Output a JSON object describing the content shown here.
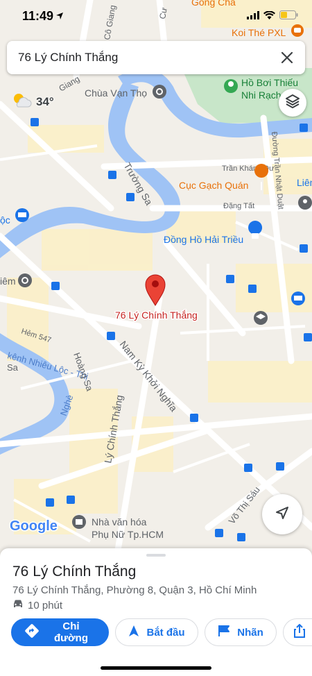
{
  "status": {
    "time": "11:49"
  },
  "search": {
    "query": "76 Lý Chính Thắng"
  },
  "weather": {
    "temp": "34°"
  },
  "map": {
    "pin_label": "76 Lý Chính Thắng",
    "logo": "Google",
    "places": {
      "gong_cha": "Gong Cha",
      "koi_the": "Koi Thé PXL",
      "ho_boi_1": "Hồ Bơi Thiếu",
      "ho_boi_2": "Nhi Rạch",
      "chua_van_tho": "Chùa Vạn Thọ",
      "cuc_gach_quan": "Cục Gạch Quán",
      "dong_ho_hai_trieu": "Đồng Hồ Hải Triều",
      "lien": "Liên",
      "loc": "ộc",
      "iem": "iêm",
      "nha_van_hoa_1": "Nhà văn hóa",
      "nha_van_hoa_2": "Phụ Nữ Tp.HCM"
    },
    "streets": {
      "co_giang": "Cô Giang",
      "giang": "Giang",
      "cu": "Cư",
      "truong_sa": "Trường Sa",
      "tran_khanh_du": "Trần Khánh Dư",
      "dang_tat": "Đặng Tất",
      "tran_nhat_duat": "Đường Trần Nhật Duật",
      "hem_547": "Hẻm 547",
      "kenh_nhieu_loc_1": "kênh Nhiêu Lộc - Thị",
      "kenh_nhieu_loc_2": "Nghè",
      "hoang_sa_1": "Hoàng Sa",
      "hoang_sa_2": "Sa",
      "nam_ky_khoi_nghia": "Nam Kỳ Khởi Nghĩa",
      "ly_chinh_thang": "Lý Chính Thắng",
      "vo_thi_sau": "Võ Thị Sáu"
    }
  },
  "sheet": {
    "title": "76 Lý Chính Thắng",
    "address": "76 Lý Chính Thắng, Phường 8, Quận 3, Hồ Chí Minh",
    "travel_time": "10 phút",
    "actions": {
      "directions": "Chỉ đường",
      "start": "Bắt đầu",
      "save": "Nhãn"
    }
  },
  "colors": {
    "accent": "#1a73e8",
    "water": "#9fc3f5",
    "park": "#c8e6c9",
    "road": "#ffffff",
    "major_road": "#fde9a6",
    "land": "#f2efe9",
    "pin": "#ea4335"
  }
}
